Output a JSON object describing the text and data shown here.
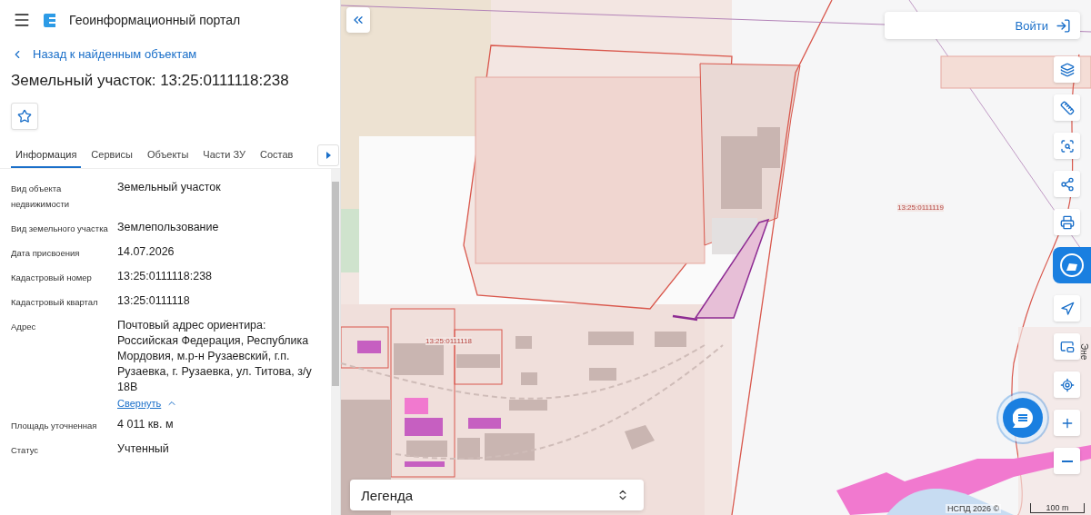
{
  "header": {
    "title": "Геоинформационный портал"
  },
  "back_link": "Назад к найденным объектам",
  "object_title": "Земельный участок: 13:25:0111118:238",
  "tabs": [
    {
      "label": "Информация",
      "selected": true
    },
    {
      "label": "Сервисы",
      "selected": false
    },
    {
      "label": "Объекты",
      "selected": false
    },
    {
      "label": "Части ЗУ",
      "selected": false
    },
    {
      "label": "Состав",
      "selected": false
    }
  ],
  "details": [
    {
      "label": "Вид объекта недвижимости",
      "value": "Земельный участок"
    },
    {
      "label": "Вид земельного участка",
      "value": "Землепользование"
    },
    {
      "label": "Дата присвоения",
      "value": "14.07.2026"
    },
    {
      "label": "Кадастровый номер",
      "value": "13:25:0111118:238"
    },
    {
      "label": "Кадастровый квартал",
      "value": "13:25:0111118"
    },
    {
      "label": "Адрес",
      "value": "Почтовый адрес ориентира: Российская Федерация, Республика Мордовия, м.р-н Рузаевский, г.п. Рузаевка, г. Рузаевка, ул. Титова, з/у 18В",
      "collapse_link": "Свернуть"
    },
    {
      "label": "Площадь уточненная",
      "value": "4 011 кв. м"
    },
    {
      "label": "Статус",
      "value": "Учтенный"
    }
  ],
  "map": {
    "login": "Войти",
    "legend": "Легенда",
    "attribution": "НСПД 2026 ©",
    "scale": "100 m",
    "labels": [
      {
        "text": "13:25:0111119",
        "kind": "quarter"
      },
      {
        "text": "13:25:0111118",
        "kind": "quarter"
      },
      {
        "text": "Эне",
        "kind": "street"
      }
    ]
  }
}
